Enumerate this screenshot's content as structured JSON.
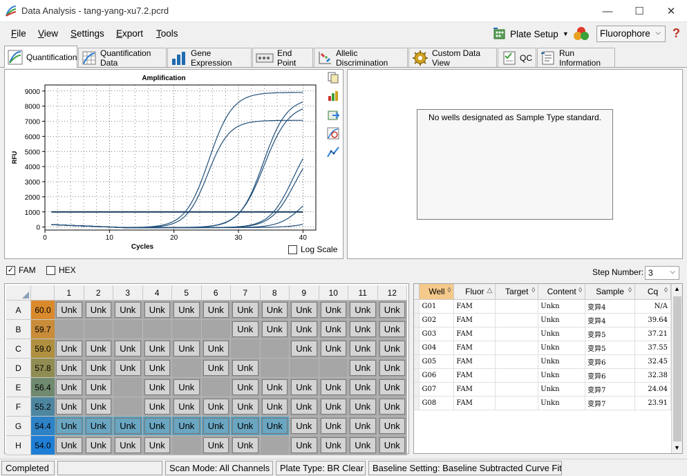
{
  "window": {
    "title": "Data Analysis - tang-yang-xu7.2.pcrd"
  },
  "menu": {
    "file": "File",
    "view": "View",
    "settings": "Settings",
    "export": "Export",
    "tools": "Tools"
  },
  "toolbar": {
    "plate_setup": "Plate Setup",
    "fluorophore": "Fluorophore",
    "help": "?"
  },
  "tabs": [
    "Quantification",
    "Quantification Data",
    "Gene Expression",
    "End Point",
    "Allelic Discrimination",
    "Custom Data View",
    "QC",
    "Run Information"
  ],
  "std_message": "No wells designated as Sample Type standard.",
  "log_scale_label": "Log Scale",
  "filters": {
    "fam": "FAM",
    "hex": "HEX",
    "step_label": "Step Number:",
    "step_value": "3"
  },
  "plate": {
    "columns": [
      "1",
      "2",
      "3",
      "4",
      "5",
      "6",
      "7",
      "8",
      "9",
      "10",
      "11",
      "12"
    ],
    "rows": [
      {
        "label": "A",
        "temp": "60.0",
        "color": "#d98a2c",
        "wells": [
          "Unk",
          "Unk",
          "Unk",
          "Unk",
          "Unk",
          "Unk",
          "Unk",
          "Unk",
          "Unk",
          "Unk",
          "Unk",
          "Unk"
        ]
      },
      {
        "label": "B",
        "temp": "59.7",
        "color": "#c98c3a",
        "wells": [
          "",
          "",
          "",
          "",
          "",
          "",
          "Unk",
          "Unk",
          "Unk",
          "Unk",
          "Unk",
          "Unk"
        ]
      },
      {
        "label": "C",
        "temp": "59.0",
        "color": "#b09040",
        "wells": [
          "Unk",
          "Unk",
          "Unk",
          "Unk",
          "Unk",
          "Unk",
          "",
          "",
          "Unk",
          "Unk",
          "Unk",
          "Unk"
        ]
      },
      {
        "label": "D",
        "temp": "57.8",
        "color": "#918c52",
        "wells": [
          "Unk",
          "Unk",
          "Unk",
          "Unk",
          "",
          "Unk",
          "Unk",
          "",
          "",
          "",
          "Unk",
          "Unk"
        ]
      },
      {
        "label": "E",
        "temp": "56.4",
        "color": "#6f8a6e",
        "wells": [
          "Unk",
          "Unk",
          "",
          "Unk",
          "Unk",
          "",
          "Unk",
          "Unk",
          "Unk",
          "Unk",
          "Unk",
          "Unk"
        ]
      },
      {
        "label": "F",
        "temp": "55.2",
        "color": "#4e86a0",
        "wells": [
          "Unk",
          "Unk",
          "",
          "Unk",
          "Unk",
          "Unk",
          "Unk",
          "Unk",
          "Unk",
          "Unk",
          "Unk",
          "Unk"
        ]
      },
      {
        "label": "G",
        "temp": "54.4",
        "color": "#2e82c6",
        "wells": [
          "Unk",
          "Unk",
          "Unk",
          "Unk",
          "Unk",
          "Unk",
          "Unk",
          "Unk",
          "Unk",
          "Unk",
          "Unk",
          "Unk"
        ]
      },
      {
        "label": "H",
        "temp": "54.0",
        "color": "#1f7fd6",
        "wells": [
          "Unk",
          "Unk",
          "Unk",
          "Unk",
          "",
          "Unk",
          "Unk",
          "",
          "Unk",
          "Unk",
          "Unk",
          "Unk"
        ]
      }
    ]
  },
  "results": {
    "headers": [
      "Well",
      "Fluor",
      "Target",
      "Content",
      "Sample",
      "Cq"
    ],
    "rows": [
      [
        "G01",
        "FAM",
        "",
        "Unkn",
        "变异4",
        "N/A"
      ],
      [
        "G02",
        "FAM",
        "",
        "Unkn",
        "变异4",
        "39.64"
      ],
      [
        "G03",
        "FAM",
        "",
        "Unkn",
        "变异5",
        "37.21"
      ],
      [
        "G04",
        "FAM",
        "",
        "Unkn",
        "变异5",
        "37.55"
      ],
      [
        "G05",
        "FAM",
        "",
        "Unkn",
        "变异6",
        "32.45"
      ],
      [
        "G06",
        "FAM",
        "",
        "Unkn",
        "变异6",
        "32.38"
      ],
      [
        "G07",
        "FAM",
        "",
        "Unkn",
        "变异7",
        "24.04"
      ],
      [
        "G08",
        "FAM",
        "",
        "Unkn",
        "变异7",
        "23.91"
      ]
    ]
  },
  "status": {
    "state": "Completed",
    "scan_mode": "Scan Mode: All Channels",
    "plate_type": "Plate Type: BR Clear",
    "baseline": "Baseline Setting: Baseline Subtracted Curve Fit"
  },
  "chart_data": {
    "type": "line",
    "title": "Amplification",
    "xlabel": "Cycles",
    "ylabel": "RFU",
    "xlim": [
      0,
      42
    ],
    "ylim": [
      -200,
      9400
    ],
    "xticks": [
      0,
      10,
      20,
      30,
      40
    ],
    "yticks": [
      0,
      1000,
      2000,
      3000,
      4000,
      5000,
      6000,
      7000,
      8000,
      9000
    ],
    "threshold": 1000,
    "grid": true,
    "line_color": "#1f4e79",
    "threshold_color": "#163a5c",
    "series": [
      {
        "cq": 23.91,
        "plateau": 8950,
        "k": 0.55,
        "start": 1
      },
      {
        "cq": 24.04,
        "plateau": 7100,
        "k": 0.6,
        "start": 1
      },
      {
        "cq": 32.38,
        "plateau": 8600,
        "k": 0.55,
        "start": 1
      },
      {
        "cq": 32.45,
        "plateau": 8200,
        "k": 0.52,
        "start": 1
      },
      {
        "cq": 37.21,
        "plateau": 6500,
        "k": 0.55,
        "start": 1
      },
      {
        "cq": 37.55,
        "plateau": 5800,
        "k": 0.55,
        "start": 1
      },
      {
        "cq": 39.64,
        "plateau": 3000,
        "k": 0.55,
        "start": 1
      },
      {
        "cq": 45,
        "plateau": 3000,
        "k": 0.45,
        "start": 1
      }
    ]
  }
}
